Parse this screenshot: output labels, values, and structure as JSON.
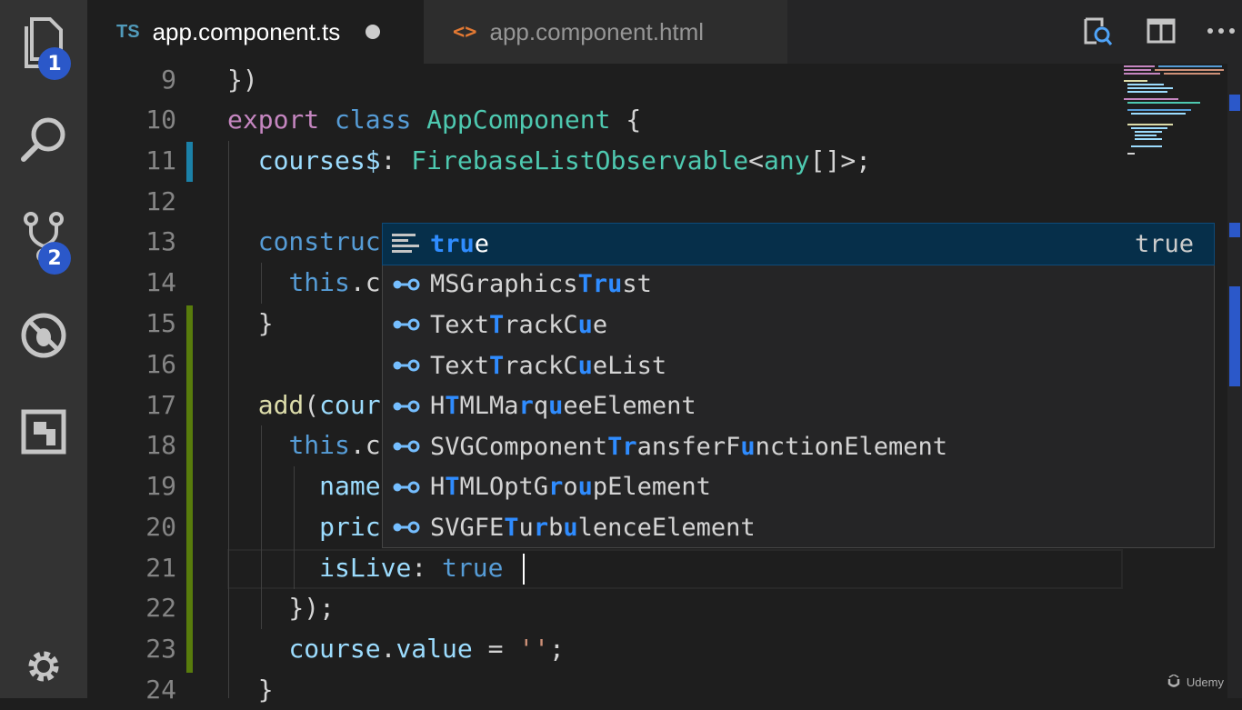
{
  "activity_bar": {
    "explorer_badge": "1",
    "scm_badge": "2"
  },
  "tabs": [
    {
      "badge": "TS",
      "label": "app.component.ts"
    },
    {
      "badge": "<>",
      "label": "app.component.html"
    }
  ],
  "editor": {
    "line_numbers": [
      "9",
      "10",
      "11",
      "12",
      "13",
      "14",
      "15",
      "16",
      "17",
      "18",
      "19",
      "20",
      "21",
      "22",
      "23",
      "24"
    ]
  },
  "suggest": {
    "selected_detail": "true",
    "items": [
      {
        "icon": "snippet-icon",
        "parts": [
          {
            "t": "tru",
            "m": true
          },
          {
            "t": "e",
            "m": false
          }
        ]
      },
      {
        "icon": "interface-icon",
        "parts": [
          {
            "t": "MSGraphics",
            "m": false
          },
          {
            "t": "Tru",
            "m": true
          },
          {
            "t": "st",
            "m": false
          }
        ]
      },
      {
        "icon": "interface-icon",
        "parts": [
          {
            "t": "Text",
            "m": false
          },
          {
            "t": "T",
            "m": true
          },
          {
            "t": "rackC",
            "m": false
          },
          {
            "t": "u",
            "m": true
          },
          {
            "t": "e",
            "m": false
          }
        ]
      },
      {
        "icon": "interface-icon",
        "parts": [
          {
            "t": "Text",
            "m": false
          },
          {
            "t": "T",
            "m": true
          },
          {
            "t": "rackC",
            "m": false
          },
          {
            "t": "u",
            "m": true
          },
          {
            "t": "eList",
            "m": false
          }
        ]
      },
      {
        "icon": "interface-icon",
        "parts": [
          {
            "t": "H",
            "m": false
          },
          {
            "t": "T",
            "m": true
          },
          {
            "t": "MLMa",
            "m": false
          },
          {
            "t": "r",
            "m": true
          },
          {
            "t": "q",
            "m": false
          },
          {
            "t": "u",
            "m": true
          },
          {
            "t": "eeElement",
            "m": false
          }
        ]
      },
      {
        "icon": "interface-icon",
        "parts": [
          {
            "t": "SVGComponent",
            "m": false
          },
          {
            "t": "Tr",
            "m": true
          },
          {
            "t": "ansferF",
            "m": false
          },
          {
            "t": "u",
            "m": true
          },
          {
            "t": "nctionElement",
            "m": false
          }
        ]
      },
      {
        "icon": "interface-icon",
        "parts": [
          {
            "t": "H",
            "m": false
          },
          {
            "t": "T",
            "m": true
          },
          {
            "t": "MLOptG",
            "m": false
          },
          {
            "t": "r",
            "m": true
          },
          {
            "t": "o",
            "m": false
          },
          {
            "t": "u",
            "m": true
          },
          {
            "t": "pElement",
            "m": false
          }
        ]
      },
      {
        "icon": "interface-icon",
        "parts": [
          {
            "t": "SVGFE",
            "m": false
          },
          {
            "t": "T",
            "m": true
          },
          {
            "t": "u",
            "m": false
          },
          {
            "t": "r",
            "m": true
          },
          {
            "t": "b",
            "m": false
          },
          {
            "t": "u",
            "m": true
          },
          {
            "t": "lenceElement",
            "m": false
          }
        ]
      }
    ]
  },
  "watermark": "Udemy",
  "colors": {
    "keyword": "#c586c0",
    "type": "#4ec9b0",
    "property": "#9cdcfe",
    "match_highlight": "#2f8cff",
    "selection": "#062f4a",
    "git_modified": "#1b81a8",
    "git_added": "#587c0c"
  }
}
